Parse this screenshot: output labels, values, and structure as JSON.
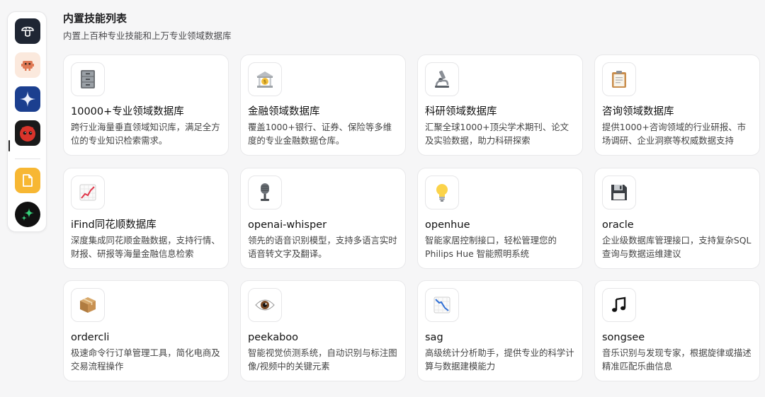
{
  "dock": {
    "apps": [
      {
        "name": "mushroom-app",
        "icon": "mushroom-icon",
        "bg": "#1f2633"
      },
      {
        "name": "robot-app",
        "icon": "robot-icon",
        "bg": "#fbe9dd"
      },
      {
        "name": "sparkle-app",
        "icon": "sparkle-icon",
        "bg": "#1b3f8f"
      },
      {
        "name": "monster-app",
        "icon": "monster-icon",
        "bg": "#1a1a1a"
      },
      {
        "name": "notes-app",
        "icon": "document-icon",
        "bg": "#f7b733"
      },
      {
        "name": "stars-app",
        "icon": "stars-icon",
        "bg": "#111111"
      }
    ]
  },
  "header": {
    "title": "内置技能列表",
    "subtitle": "内置上百种专业技能和上万专业领域数据库"
  },
  "cards": [
    {
      "icon": "file-cabinet-icon",
      "title": "10000+专业领域数据库",
      "desc": "跨行业海量垂直领域知识库，满足全方位的专业知识检索需求。"
    },
    {
      "icon": "bank-icon",
      "title": "金融领域数据库",
      "desc": "覆盖1000+银行、证券、保险等多维度的专业金融数据仓库。"
    },
    {
      "icon": "microscope-icon",
      "title": "科研领域数据库",
      "desc": "汇聚全球1000+顶尖学术期刊、论文及实验数据，助力科研探索"
    },
    {
      "icon": "clipboard-icon",
      "title": "咨询领域数据库",
      "desc": "提供1000+咨询领域的行业研报、市场调研、企业洞察等权威数据支持"
    },
    {
      "icon": "chart-up-icon",
      "title": "iFind同花顺数据库",
      "desc": "深度集成同花顺金融数据，支持行情、财报、研报等海量金融信息检索"
    },
    {
      "icon": "microphone-icon",
      "title": "openai-whisper",
      "desc": "领先的语音识别模型，支持多语言实时语音转文字及翻译。"
    },
    {
      "icon": "light-bulb-icon",
      "title": "openhue",
      "desc": "智能家居控制接口，轻松管理您的 Philips Hue 智能照明系统"
    },
    {
      "icon": "floppy-disk-icon",
      "title": "oracle",
      "desc": "企业级数据库管理接口，支持复杂SQL查询与数据运维建议"
    },
    {
      "icon": "package-icon",
      "title": "ordercli",
      "desc": "极速命令行订单管理工具，简化电商及交易流程操作"
    },
    {
      "icon": "eye-icon",
      "title": "peekaboo",
      "desc": "智能视觉侦测系统，自动识别与标注图像/视频中的关键元素"
    },
    {
      "icon": "chart-down-icon",
      "title": "sag",
      "desc": "高级统计分析助手，提供专业的科学计算与数据建模能力"
    },
    {
      "icon": "music-note-icon",
      "title": "songsee",
      "desc": "音乐识别与发现专家，根据旋律或描述精准匹配乐曲信息"
    }
  ]
}
